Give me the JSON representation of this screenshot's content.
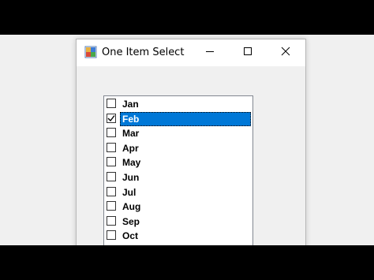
{
  "window": {
    "title": "One Item Select",
    "controls": {
      "minimize": "minimize-icon",
      "maximize": "maximize-icon",
      "close": "close-icon"
    }
  },
  "checklist": {
    "items": [
      {
        "label": "Jan",
        "checked": false,
        "selected": false
      },
      {
        "label": "Feb",
        "checked": true,
        "selected": true
      },
      {
        "label": "Mar",
        "checked": false,
        "selected": false
      },
      {
        "label": "Apr",
        "checked": false,
        "selected": false
      },
      {
        "label": "May",
        "checked": false,
        "selected": false
      },
      {
        "label": "Jun",
        "checked": false,
        "selected": false
      },
      {
        "label": "Jul",
        "checked": false,
        "selected": false
      },
      {
        "label": "Aug",
        "checked": false,
        "selected": false
      },
      {
        "label": "Sep",
        "checked": false,
        "selected": false
      },
      {
        "label": "Oct",
        "checked": false,
        "selected": false
      }
    ]
  },
  "colors": {
    "selection": "#0078d7",
    "window_bg": "#f0f0f0",
    "letterbox": "#000000"
  }
}
